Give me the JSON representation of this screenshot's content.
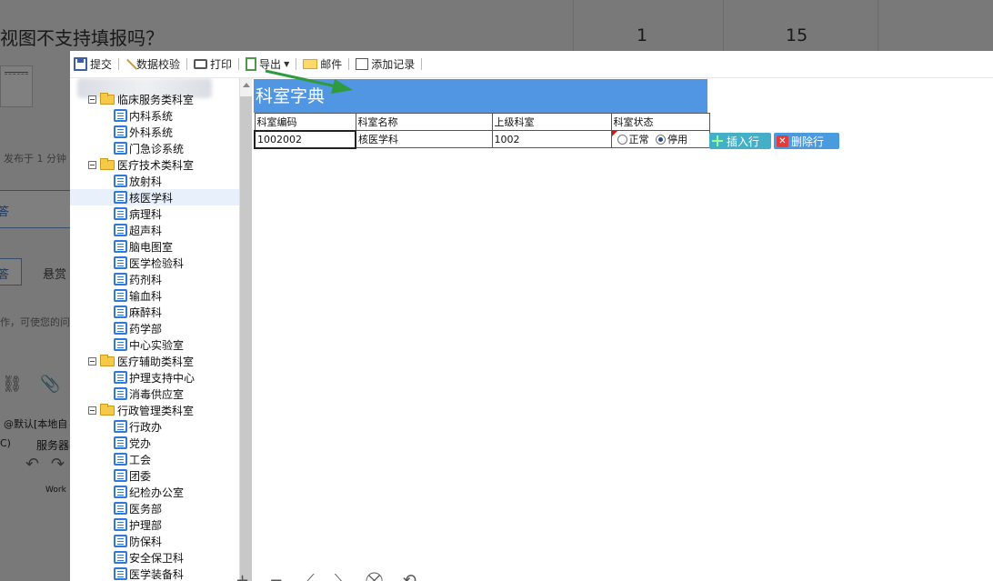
{
  "background": {
    "title": "视图不支持填报吗？",
    "num1": "1",
    "num2": "15",
    "posted": "发布于 1 分钟",
    "tab1": "答",
    "tab2": "悬赏",
    "hint": "作，可使您的问",
    "default_text": "@默认[本地自",
    "left_text": "C)",
    "server": "服务器",
    "work": "Work"
  },
  "toolbar": [
    {
      "label": "提交",
      "icon": "save-icon"
    },
    {
      "label": "数据校验",
      "icon": "check-icon"
    },
    {
      "label": "打印",
      "icon": "print-icon"
    },
    {
      "label": "导出",
      "icon": "export-icon",
      "dropdown": true
    },
    {
      "label": "邮件",
      "icon": "mail-icon"
    },
    {
      "label": "添加记录",
      "icon": "add-record-icon"
    }
  ],
  "tree": {
    "nodes": [
      {
        "level": 1,
        "type": "folder",
        "label": "临床服务类科室"
      },
      {
        "level": 2,
        "type": "leaf",
        "label": "内科系统"
      },
      {
        "level": 2,
        "type": "leaf",
        "label": "外科系统"
      },
      {
        "level": 2,
        "type": "leaf",
        "label": "门急诊系统"
      },
      {
        "level": 1,
        "type": "folder",
        "label": "医疗技术类科室"
      },
      {
        "level": 2,
        "type": "leaf",
        "label": "放射科"
      },
      {
        "level": 2,
        "type": "leaf",
        "label": "核医学科",
        "selected": true
      },
      {
        "level": 2,
        "type": "leaf",
        "label": "病理科"
      },
      {
        "level": 2,
        "type": "leaf",
        "label": "超声科"
      },
      {
        "level": 2,
        "type": "leaf",
        "label": "脑电图室"
      },
      {
        "level": 2,
        "type": "leaf",
        "label": "医学检验科"
      },
      {
        "level": 2,
        "type": "leaf",
        "label": "药剂科"
      },
      {
        "level": 2,
        "type": "leaf",
        "label": "输血科"
      },
      {
        "level": 2,
        "type": "leaf",
        "label": "麻醉科"
      },
      {
        "level": 2,
        "type": "leaf",
        "label": "药学部"
      },
      {
        "level": 2,
        "type": "leaf",
        "label": "中心实验室"
      },
      {
        "level": 1,
        "type": "folder",
        "label": "医疗辅助类科室"
      },
      {
        "level": 2,
        "type": "leaf",
        "label": "护理支持中心"
      },
      {
        "level": 2,
        "type": "leaf",
        "label": "消毒供应室"
      },
      {
        "level": 1,
        "type": "folder",
        "label": "行政管理类科室"
      },
      {
        "level": 2,
        "type": "leaf",
        "label": "行政办"
      },
      {
        "level": 2,
        "type": "leaf",
        "label": "党办"
      },
      {
        "level": 2,
        "type": "leaf",
        "label": "工会"
      },
      {
        "level": 2,
        "type": "leaf",
        "label": "团委"
      },
      {
        "level": 2,
        "type": "leaf",
        "label": "纪检办公室"
      },
      {
        "level": 2,
        "type": "leaf",
        "label": "医务部"
      },
      {
        "level": 2,
        "type": "leaf",
        "label": "护理部"
      },
      {
        "level": 2,
        "type": "leaf",
        "label": "防保科"
      },
      {
        "level": 2,
        "type": "leaf",
        "label": "安全保卫科"
      },
      {
        "level": 2,
        "type": "leaf",
        "label": "医学装备科"
      }
    ]
  },
  "form": {
    "title": "科室字典",
    "headers": [
      "科室编码",
      "科室名称",
      "上级科室",
      "科室状态"
    ],
    "row": {
      "code": "1002002",
      "name": "核医学科",
      "parent": "1002"
    },
    "status_options": [
      "正常",
      "停用"
    ],
    "status_selected": "停用",
    "insert_label": "插入行",
    "delete_label": "删除行"
  },
  "colors": {
    "header": "#5196e3",
    "arrow": "#2e9b3f"
  }
}
